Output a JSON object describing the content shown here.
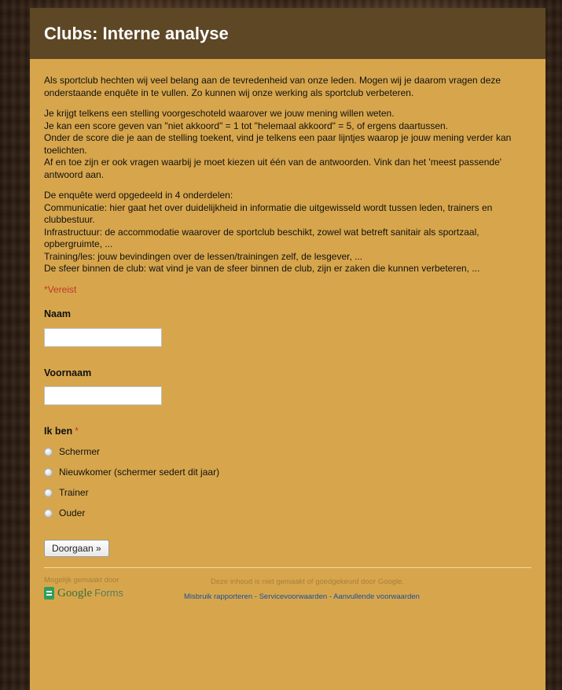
{
  "header": {
    "title": "Clubs: Interne analyse"
  },
  "description": {
    "paragraphs": [
      "Als sportclub hechten wij veel belang aan de tevredenheid van onze leden. Mogen wij je daarom vragen deze onderstaande enquête in te vullen. Zo kunnen wij onze werking als sportclub verbeteren.",
      "Je krijgt telkens een stelling voorgeschoteld waarover we jouw mening willen weten.\nJe kan een score geven van \"niet akkoord\" = 1 tot \"helemaal akkoord\" = 5, of ergens daartussen.\nOnder de score die je aan de stelling toekent, vind je telkens een paar lijntjes waarop je jouw mening verder kan toelichten.\nAf en toe zijn er ook vragen waarbij je moet kiezen uit één van de antwoorden. Vink  dan het 'meest passende' antwoord aan.",
      "De enquête werd opgedeeld in 4 onderdelen:\nCommunicatie: hier gaat het over duidelijkheid in informatie die uitgewisseld wordt tussen leden, trainers en clubbestuur.\nInfrastructuur: de accommodatie waarover de sportclub beschikt, zowel wat betreft sanitair als sportzaal, opbergruimte, ...\nTraining/les: jouw bevindingen over de lessen/trainingen zelf, de lesgever, ...\nDe sfeer binnen de club: wat vind je van de sfeer binnen de club, zijn er zaken die kunnen verbeteren, ..."
    ]
  },
  "required_note": "*Vereist",
  "questions": {
    "naam": {
      "label": "Naam",
      "value": ""
    },
    "voornaam": {
      "label": "Voornaam",
      "value": ""
    },
    "ik_ben": {
      "label": "Ik ben",
      "required_marker": "*",
      "options": [
        "Schermer",
        "Nieuwkomer (schermer sedert dit jaar)",
        "Trainer",
        "Ouder"
      ]
    }
  },
  "submit_label": "Doorgaan »",
  "footer": {
    "powered_by": "Mogelijk gemaakt door",
    "logo_word": "Google",
    "logo_product": "Forms",
    "disclaimer": "Deze inhoud is niet gemaakt of goedgekeurd door Google.",
    "links": [
      "Misbruik rapporteren",
      "Servicevoorwaarden",
      "Aanvullende voorwaarden"
    ],
    "link_separator": " - "
  },
  "colors": {
    "card_background": "#d7a64c",
    "header_background": "#5e4725",
    "required": "#c0392b",
    "link": "#1a4fa0"
  }
}
